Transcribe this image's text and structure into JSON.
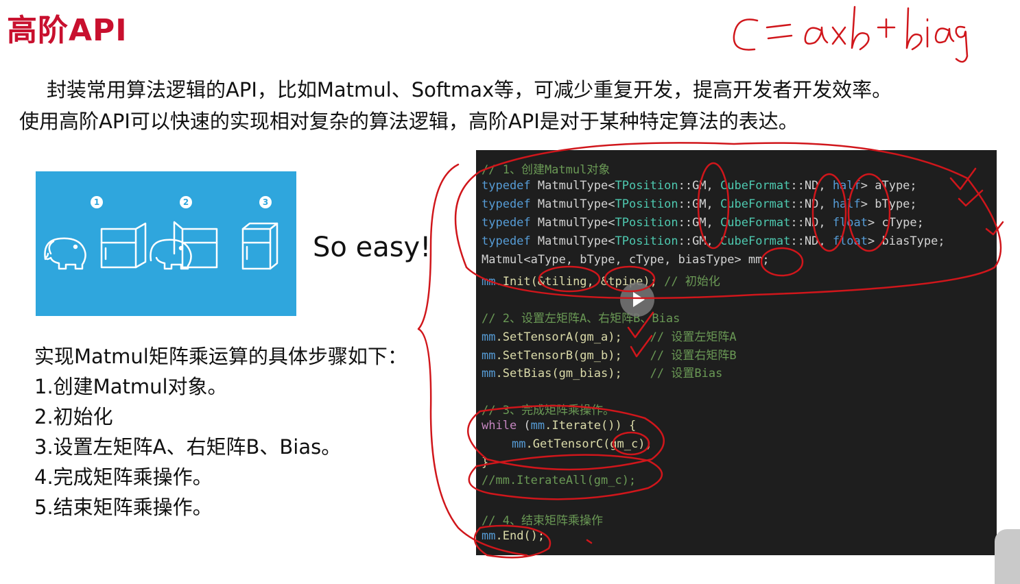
{
  "slide": {
    "title": "高阶API",
    "intro_line1": "封装常用算法逻辑的API，比如Matmul、Softmax等，可减少重复开发，提高开发者开发效率。",
    "intro_line2": "使用高阶API可以快速的实现相对复杂的算法逻辑，高阶API是对于某种特定算法的表达。",
    "so_easy": "So easy!",
    "illustration_steps": [
      "1",
      "2",
      "3"
    ],
    "steps_heading": "实现Matmul矩阵乘运算的具体步骤如下：",
    "steps": [
      "1.创建Matmul对象。",
      "2.初始化",
      "3.设置左矩阵A、右矩阵B、Bias。",
      "4.完成矩阵乘操作。",
      "5.结束矩阵乘操作。"
    ],
    "handwritten_formula": "C = a×b + bias"
  },
  "code": {
    "l1": "// 1、创建Matmul对象",
    "l2": [
      "typedef",
      " MatmulType<",
      "TPosition",
      "::GM, ",
      "CubeFormat",
      "::ND, ",
      "half",
      "> aType;"
    ],
    "l3": [
      "typedef",
      " MatmulType<",
      "TPosition",
      "::GM, ",
      "CubeFormat",
      "::ND, ",
      "half",
      "> bType;"
    ],
    "l4": [
      "typedef",
      " MatmulType<",
      "TPosition",
      "::GM, ",
      "CubeFormat",
      "::ND, ",
      "float",
      "> cType;"
    ],
    "l5": [
      "typedef",
      " MatmulType<",
      "TPosition",
      "::GM, ",
      "CubeFormat",
      "::ND, ",
      "float",
      "> biasType;"
    ],
    "l6": "Matmul<aType, bType, cType, biasType> mm;",
    "l7": [
      "mm",
      ".Init(&tiling, &tpipe); ",
      "// 初始化"
    ],
    "l8": "// 2、设置左矩阵A、右矩阵B、Bias",
    "l9": [
      "mm",
      ".SetTensorA(gm_a);    ",
      "// 设置左矩阵A"
    ],
    "l10": [
      "mm",
      ".SetTensorB(gm_b);    ",
      "// 设置右矩阵B"
    ],
    "l11": [
      "mm",
      ".SetBias(gm_bias);    ",
      "// 设置Bias"
    ],
    "l12": "// 3、完成矩阵乘操作。",
    "l13": [
      "while",
      " (",
      "mm",
      ".Iterate()) {"
    ],
    "l14": [
      "mm",
      ".GetTensorC(gm_c);"
    ],
    "l15": "}",
    "l16": "//mm.IterateAll(gm_c);",
    "l17": "// 4、结束矩阵乘操作",
    "l18": [
      "mm",
      ".End();"
    ]
  }
}
